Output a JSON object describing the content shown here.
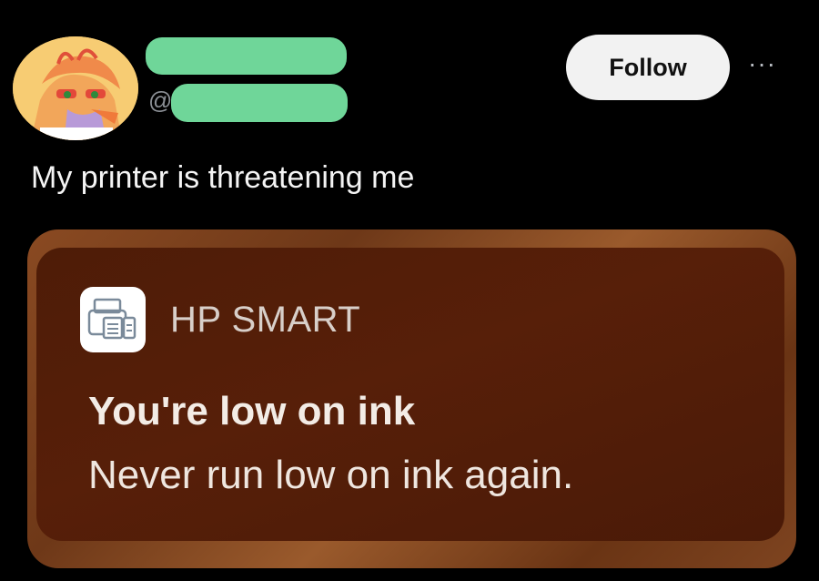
{
  "post": {
    "avatar_icon": "avatar-illustration",
    "handle_prefix": "@",
    "redaction_color": "#6fd699",
    "follow_label": "Follow",
    "more_icon": "more-icon",
    "more_glyph": "···",
    "text": "My printer is threatening me"
  },
  "notification": {
    "app_icon": "printer-icon",
    "app_name": "HP SMART",
    "title": "You're low on ink",
    "body": "Never run low on ink again."
  }
}
